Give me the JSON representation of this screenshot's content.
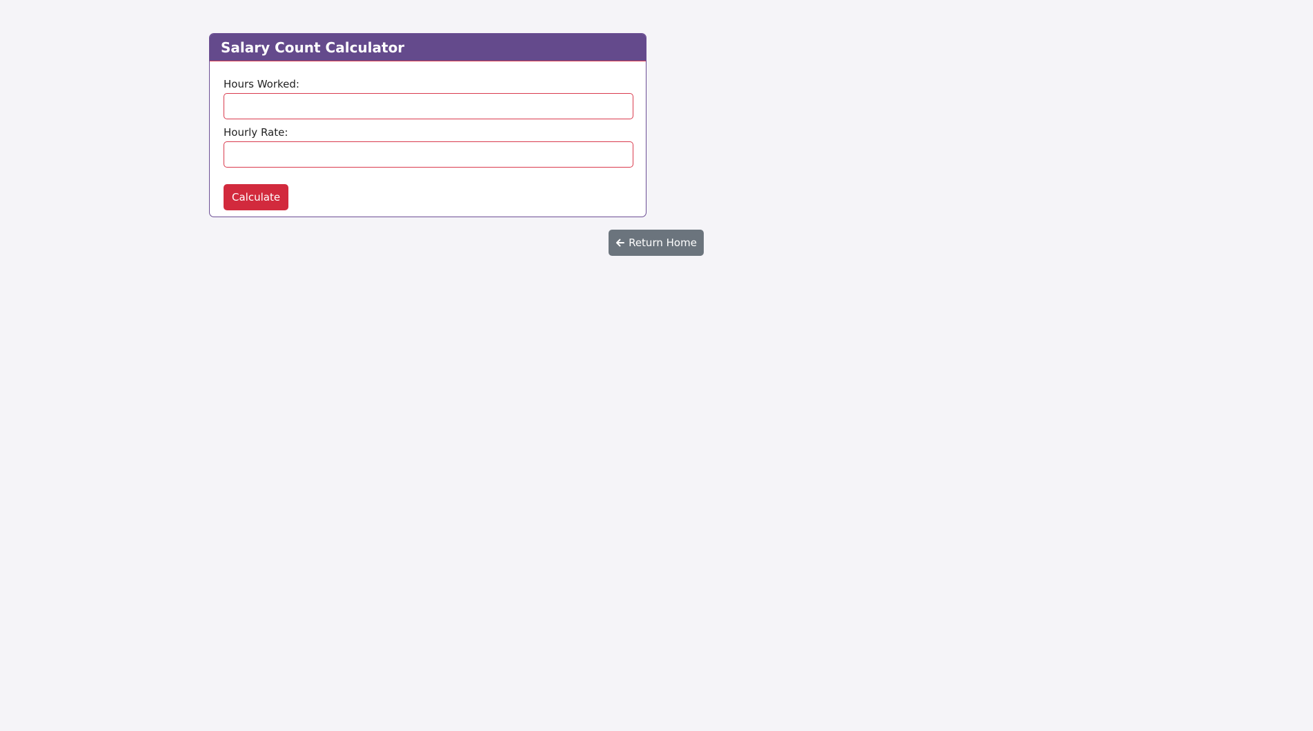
{
  "calculator": {
    "title": "Salary Count Calculator",
    "hours_label": "Hours Worked:",
    "hours_value": "",
    "rate_label": "Hourly Rate:",
    "rate_value": "",
    "calculate_label": "Calculate"
  },
  "navigation": {
    "return_label": "Return Home",
    "return_icon": "arrow-left-icon"
  },
  "colors": {
    "header": "#644a8c",
    "accent_border": "#d9394c",
    "primary_button": "#d22a3d",
    "secondary_button": "#6b747d",
    "background": "#f5f4f8"
  }
}
